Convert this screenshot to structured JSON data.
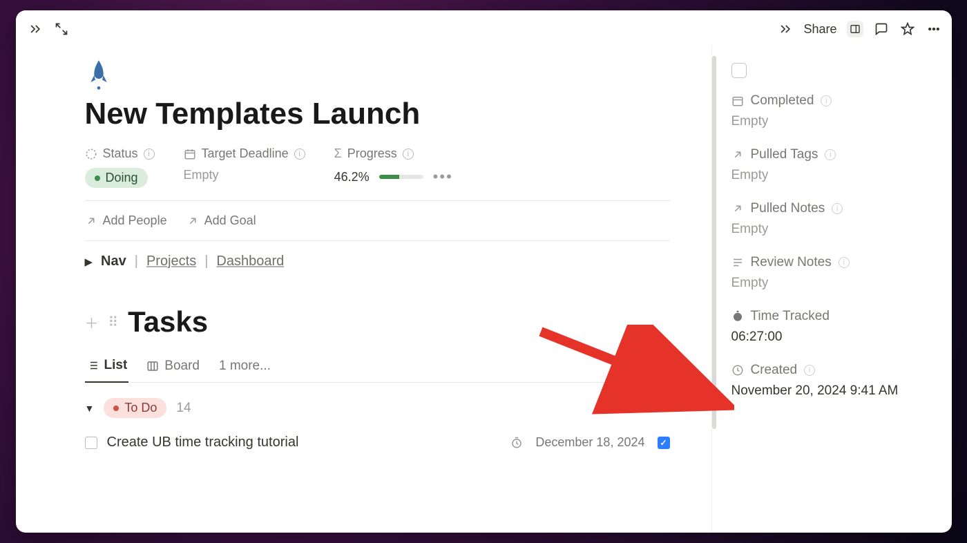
{
  "topbar": {
    "share": "Share"
  },
  "page": {
    "icon": "🚀",
    "title": "New Templates Launch",
    "props": {
      "status_label": "Status",
      "status_value": "Doing",
      "deadline_label": "Target Deadline",
      "deadline_value": "Empty",
      "progress_label": "Progress",
      "progress_value": "46.2%",
      "progress_pct": 46.2
    },
    "actions": {
      "add_people": "Add People",
      "add_goal": "Add Goal"
    },
    "nav": {
      "label": "Nav",
      "projects": "Projects",
      "dashboard": "Dashboard"
    }
  },
  "tasks": {
    "heading": "Tasks",
    "tabs": {
      "list": "List",
      "board": "Board",
      "more": "1 more..."
    },
    "group": {
      "name": "To Do",
      "count": "14"
    },
    "items": [
      {
        "title": "Create UB time tracking tutorial",
        "date": "December 18, 2024",
        "checked": true
      }
    ]
  },
  "side": {
    "completed": {
      "label": "Completed",
      "value": "Empty"
    },
    "pulled_tags": {
      "label": "Pulled Tags",
      "value": "Empty"
    },
    "pulled_notes": {
      "label": "Pulled Notes",
      "value": "Empty"
    },
    "review_notes": {
      "label": "Review Notes",
      "value": "Empty"
    },
    "time_tracked": {
      "label": "Time Tracked",
      "value": "06:27:00"
    },
    "created": {
      "label": "Created",
      "value": "November 20, 2024 9:41 AM"
    }
  }
}
